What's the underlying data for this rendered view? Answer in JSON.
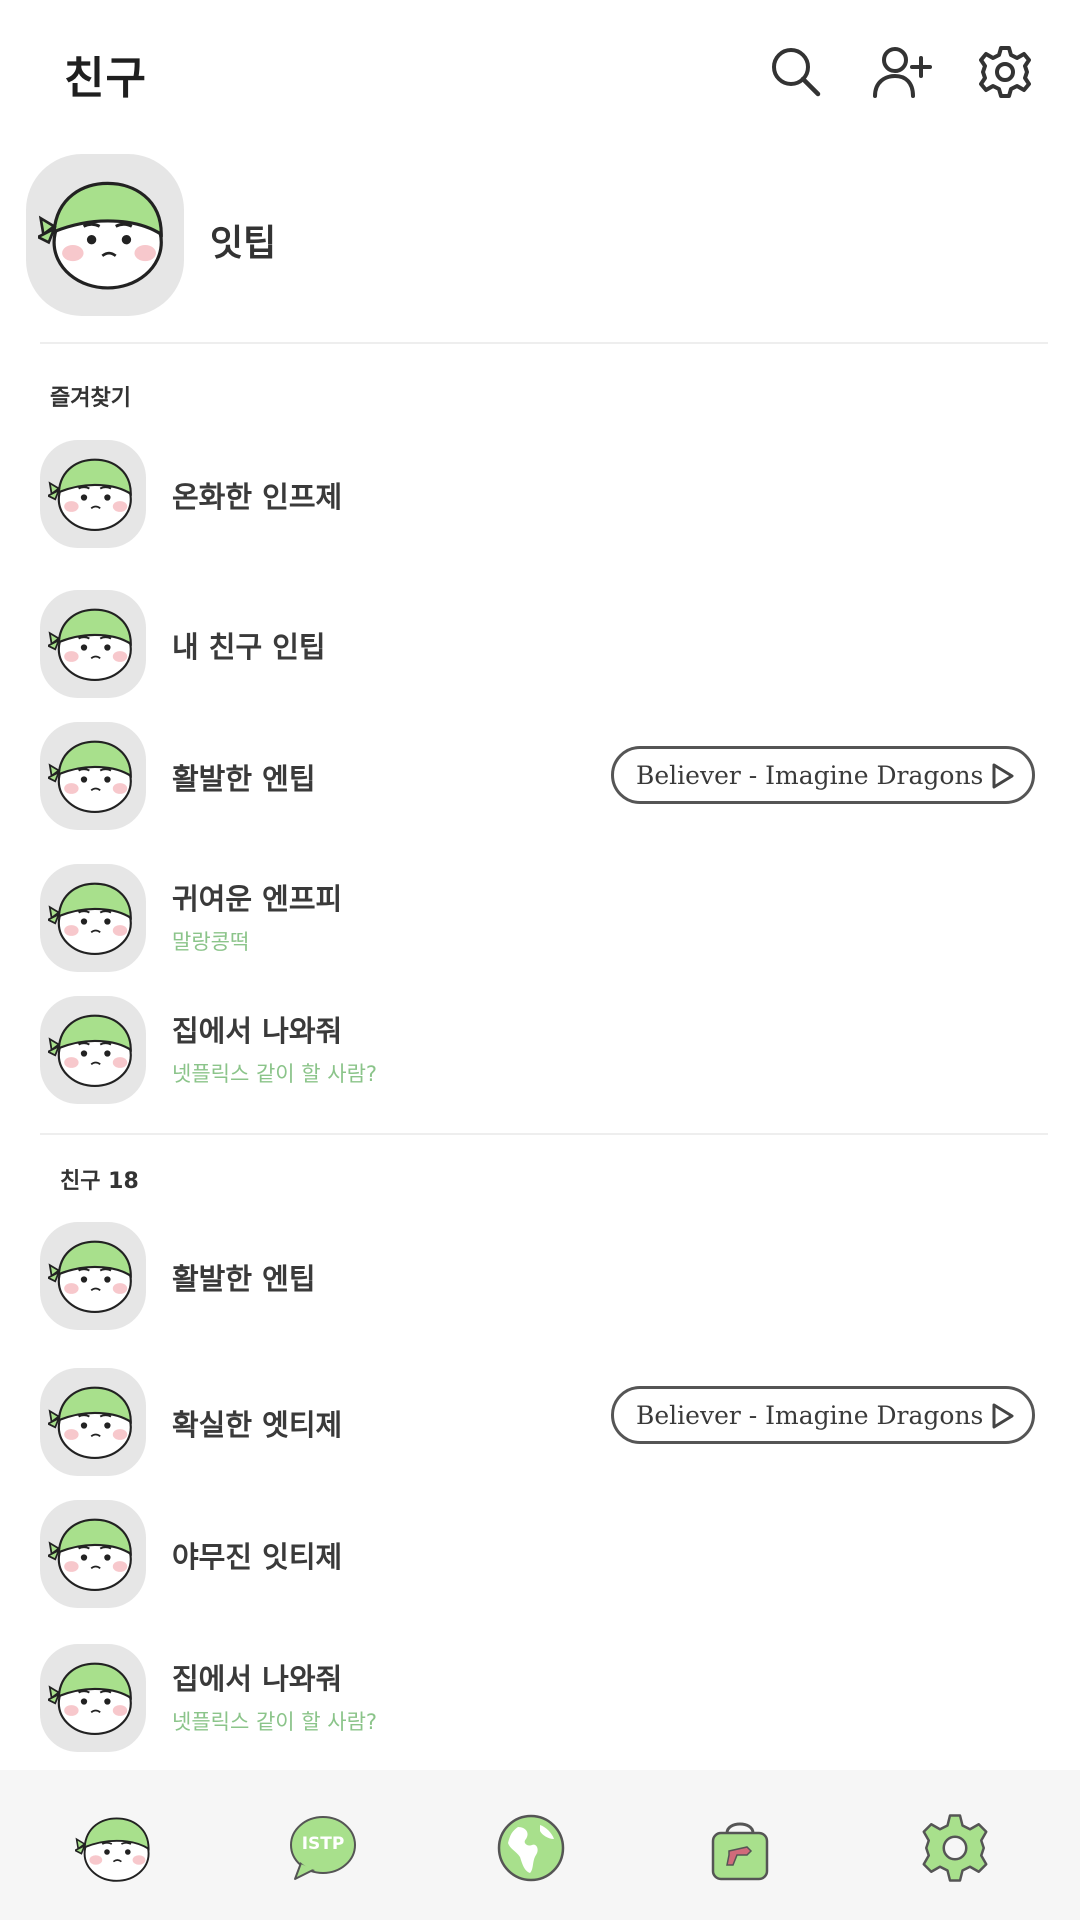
{
  "header": {
    "title": "친구",
    "icons": [
      "search-icon",
      "add-friend-icon",
      "settings-icon"
    ]
  },
  "my_profile": {
    "name": "잇팁"
  },
  "favorites": {
    "label": "즐겨찾기",
    "items": [
      {
        "name": "온화한 인프제",
        "status": "",
        "music": ""
      },
      {
        "name": "내 친구 인팁",
        "status": "",
        "music": ""
      },
      {
        "name": "활발한 엔팁",
        "status": "",
        "music": "Believer - Imagine Dragons"
      },
      {
        "name": "귀여운 엔프피",
        "status": "말랑콩떡",
        "music": ""
      },
      {
        "name": "집에서 나와줘",
        "status": "넷플릭스 같이 할 사람?",
        "music": ""
      }
    ]
  },
  "friends": {
    "label": "친구 18",
    "items": [
      {
        "name": "활발한 엔팁",
        "status": "",
        "music": ""
      },
      {
        "name": "확실한 엣티제",
        "status": "",
        "music": "Believer - Imagine Dragons"
      },
      {
        "name": "야무진 잇티제",
        "status": "",
        "music": ""
      },
      {
        "name": "집에서 나와줘",
        "status": "넷플릭스 같이 할 사람?",
        "music": ""
      }
    ]
  },
  "bottom_nav": {
    "items": [
      {
        "icon": "friends-tab-icon"
      },
      {
        "icon": "chat-tab-icon",
        "label": "ISTP"
      },
      {
        "icon": "globe-tab-icon"
      },
      {
        "icon": "shop-tab-icon"
      },
      {
        "icon": "settings-tab-icon"
      }
    ]
  },
  "colors": {
    "accent_green": "#9ed98b",
    "status_text": "#8bc48a",
    "avatar_bg": "#e6e6e6",
    "nav_bg": "#f6f6f6"
  }
}
